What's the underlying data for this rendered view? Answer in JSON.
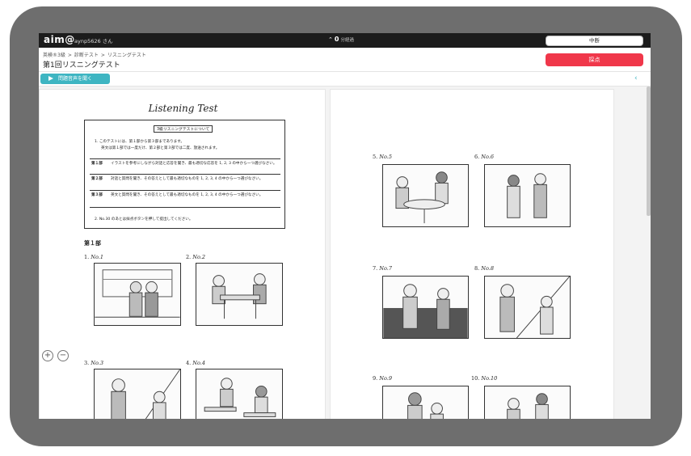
{
  "topbar": {
    "logo": "aim@",
    "user": "aynp5626 さん",
    "timer_value": "0",
    "timer_unit": "分経過",
    "pause_label": "中断"
  },
  "breadcrumb": [
    "英検®3級",
    "診断テスト",
    "リスニングテスト"
  ],
  "breadcrumb_sep": ">",
  "page_title": "第1回リスニングテスト",
  "submit_label": "採点",
  "audio_label": "問題音声を聞く",
  "collapse_icon": "‹",
  "doc": {
    "title": "Listening Test",
    "instructions": {
      "heading": "3級リスニングテストについて",
      "line1": "1. このテストには、第１部から第３部まであります。",
      "line2": "英文は第１部では一度だけ、第２部と第３部では二度、放送されます。",
      "parts": [
        {
          "label": "第１部",
          "text": "イラストを参考にしながら対話と応答を聞き、最も適切な応答を 1, 2, 3 の中から一つ選びなさい。"
        },
        {
          "label": "第２部",
          "text": "対話と質問を聞き、その答えとして最も適切なものを 1, 2, 3, 4 の中から一つ選びなさい。"
        },
        {
          "label": "第３部",
          "text": "英文と質問を聞き、その答えとして最も適切なものを 1, 2, 3, 4 の中から一つ選びなさい。"
        }
      ],
      "line3": "2. No.30 のあとは採点ボタンを押して提出してください。"
    },
    "section1": "第１部",
    "questions": [
      {
        "num": "1.",
        "label": "No.1"
      },
      {
        "num": "2.",
        "label": "No.2"
      },
      {
        "num": "3.",
        "label": "No.3"
      },
      {
        "num": "4.",
        "label": "No.4"
      },
      {
        "num": "5.",
        "label": "No.5"
      },
      {
        "num": "6.",
        "label": "No.6"
      },
      {
        "num": "7.",
        "label": "No.7"
      },
      {
        "num": "8.",
        "label": "No.8"
      },
      {
        "num": "9.",
        "label": "No.9"
      },
      {
        "num": "10.",
        "label": "No.10"
      }
    ]
  },
  "zoom": {
    "in": "+",
    "out": "−"
  },
  "colors": {
    "accent": "#3eb5c2",
    "submit": "#f0374a",
    "topbar": "#1c1c1c"
  }
}
